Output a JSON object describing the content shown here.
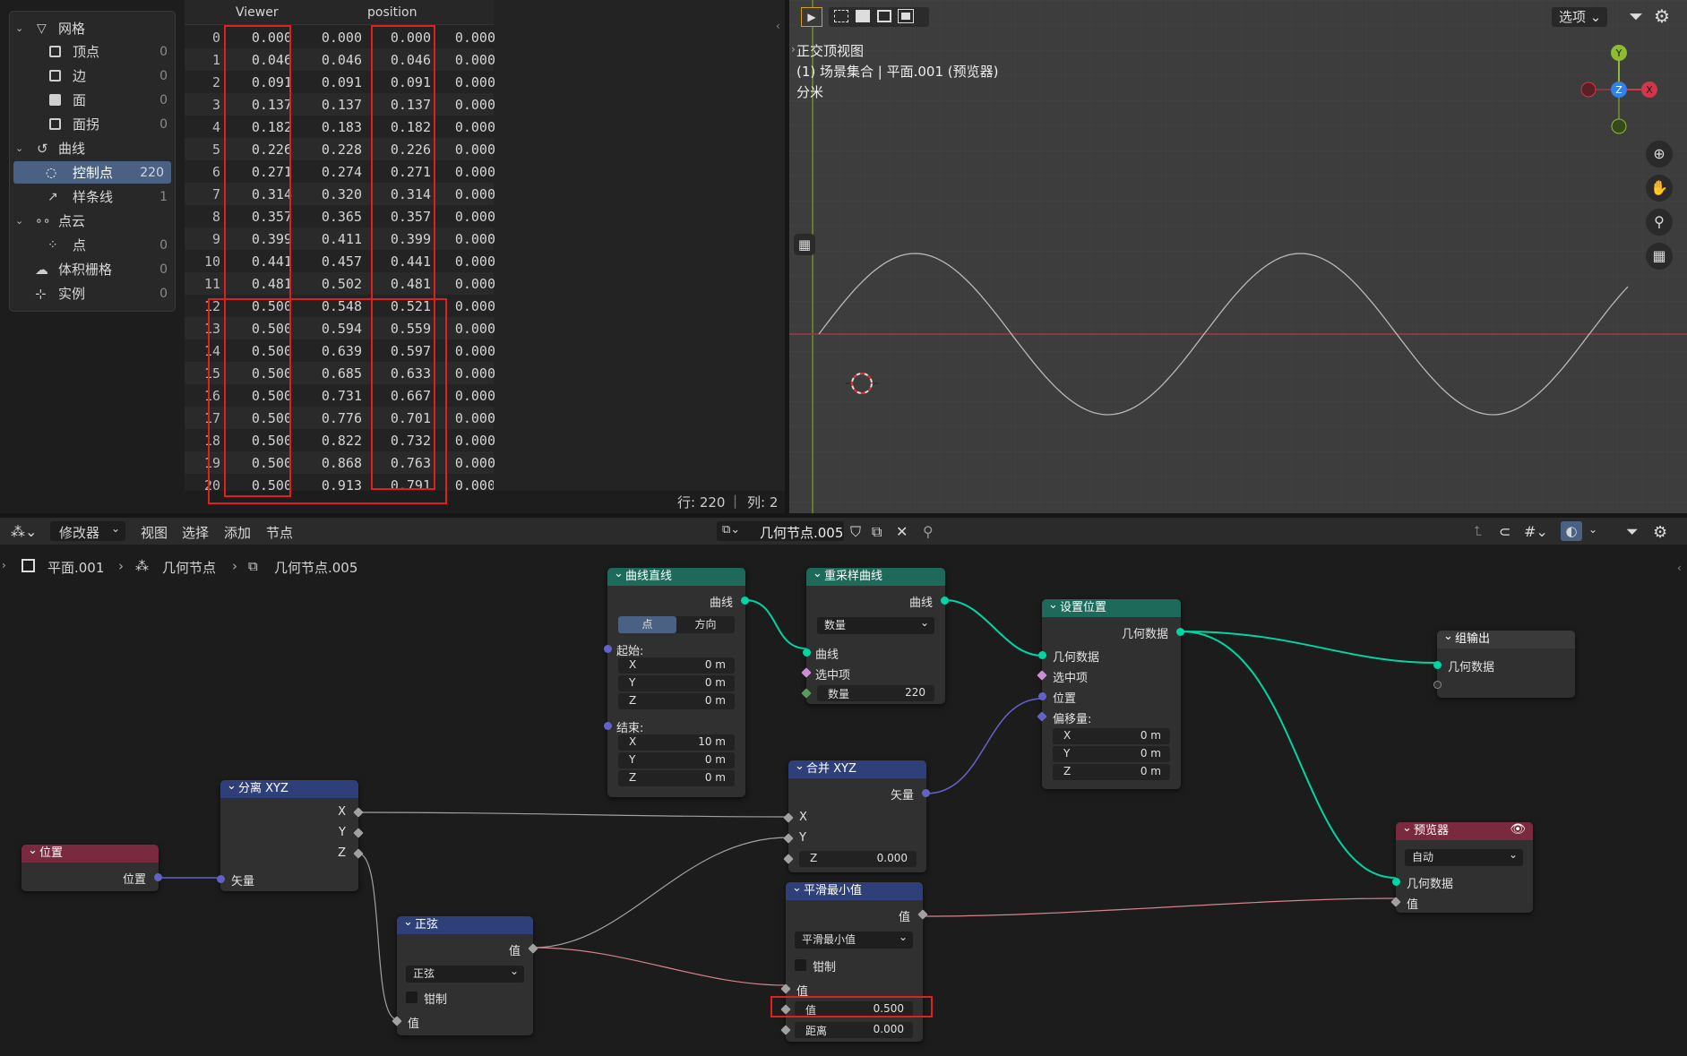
{
  "sidebar": {
    "items": [
      {
        "label": "网格",
        "count": ""
      },
      {
        "label": "顶点",
        "count": "0"
      },
      {
        "label": "边",
        "count": "0"
      },
      {
        "label": "面",
        "count": "0"
      },
      {
        "label": "面拐",
        "count": "0"
      },
      {
        "label": "曲线",
        "count": ""
      },
      {
        "label": "控制点",
        "count": "220"
      },
      {
        "label": "样条线",
        "count": "1"
      },
      {
        "label": "点云",
        "count": ""
      },
      {
        "label": "点",
        "count": "0"
      },
      {
        "label": "体积栅格",
        "count": "0"
      },
      {
        "label": "实例",
        "count": "0"
      }
    ]
  },
  "sheet": {
    "col_viewer": "Viewer",
    "col_position": "position",
    "rows": [
      [
        "0",
        "0.000",
        "0.000",
        "0.000",
        "0.000"
      ],
      [
        "1",
        "0.046",
        "0.046",
        "0.046",
        "0.000"
      ],
      [
        "2",
        "0.091",
        "0.091",
        "0.091",
        "0.000"
      ],
      [
        "3",
        "0.137",
        "0.137",
        "0.137",
        "0.000"
      ],
      [
        "4",
        "0.182",
        "0.183",
        "0.182",
        "0.000"
      ],
      [
        "5",
        "0.226",
        "0.228",
        "0.226",
        "0.000"
      ],
      [
        "6",
        "0.271",
        "0.274",
        "0.271",
        "0.000"
      ],
      [
        "7",
        "0.314",
        "0.320",
        "0.314",
        "0.000"
      ],
      [
        "8",
        "0.357",
        "0.365",
        "0.357",
        "0.000"
      ],
      [
        "9",
        "0.399",
        "0.411",
        "0.399",
        "0.000"
      ],
      [
        "10",
        "0.441",
        "0.457",
        "0.441",
        "0.000"
      ],
      [
        "11",
        "0.481",
        "0.502",
        "0.481",
        "0.000"
      ],
      [
        "12",
        "0.500",
        "0.548",
        "0.521",
        "0.000"
      ],
      [
        "13",
        "0.500",
        "0.594",
        "0.559",
        "0.000"
      ],
      [
        "14",
        "0.500",
        "0.639",
        "0.597",
        "0.000"
      ],
      [
        "15",
        "0.500",
        "0.685",
        "0.633",
        "0.000"
      ],
      [
        "16",
        "0.500",
        "0.731",
        "0.667",
        "0.000"
      ],
      [
        "17",
        "0.500",
        "0.776",
        "0.701",
        "0.000"
      ],
      [
        "18",
        "0.500",
        "0.822",
        "0.732",
        "0.000"
      ],
      [
        "19",
        "0.500",
        "0.868",
        "0.763",
        "0.000"
      ],
      [
        "20",
        "0.500",
        "0.913",
        "0.791",
        "0.000"
      ]
    ],
    "rows_label": "行: 220",
    "cols_label": "列: 2"
  },
  "viewport": {
    "options": "选项",
    "view_name": "正交顶视图",
    "collection": "(1) 场景集合 | 平面.001 (预览器)",
    "units": "分米",
    "axis_x": "X",
    "axis_y": "Y",
    "axis_z": "Z"
  },
  "node_header": {
    "modifier": "修改器",
    "menu_view": "视图",
    "menu_select": "选择",
    "menu_add": "添加",
    "menu_node": "节点",
    "tree_name": "几何节点.005",
    "crumb_object": "平面.001",
    "crumb_modifier": "几何节点",
    "crumb_tree": "几何节点.005"
  },
  "nodes": {
    "curve_line": {
      "title": "曲线直线",
      "out": "曲线",
      "tab_point": "点",
      "tab_dir": "方向",
      "start": "起始:",
      "end": "结束:",
      "sx": "0 m",
      "sy": "0 m",
      "sz": "0 m",
      "ex": "10 m",
      "ey": "0 m",
      "ez": "0 m",
      "x": "X",
      "y": "Y",
      "z": "Z"
    },
    "resample": {
      "title": "重采样曲线",
      "out": "曲线",
      "mode": "数量",
      "in_curve": "曲线",
      "in_sel": "选中项",
      "count_label": "数量",
      "count": "220"
    },
    "set_pos": {
      "title": "设置位置",
      "out": "几何数据",
      "in_geo": "几何数据",
      "in_sel": "选中项",
      "in_pos": "位置",
      "in_off": "偏移量:",
      "ox": "0 m",
      "oy": "0 m",
      "oz": "0 m",
      "x": "X",
      "y": "Y",
      "z": "Z"
    },
    "group_out": {
      "title": "组输出",
      "in_geo": "几何数据"
    },
    "separate": {
      "title": "分离 XYZ",
      "x": "X",
      "y": "Y",
      "z": "Z",
      "in": "矢量"
    },
    "position": {
      "title": "位置",
      "out": "位置"
    },
    "combine": {
      "title": "合并 XYZ",
      "out": "矢量",
      "x": "X",
      "y": "Y",
      "z_label": "Z",
      "z": "0.000"
    },
    "sine": {
      "title": "正弦",
      "out": "值",
      "mode": "正弦",
      "clamp": "钳制",
      "in": "值"
    },
    "smooth_min": {
      "title": "平滑最小值",
      "out": "值",
      "mode": "平滑最小值",
      "clamp": "钳制",
      "in": "值",
      "val_label": "值",
      "val": "0.500",
      "dist_label": "距离",
      "dist": "0.000"
    },
    "viewer": {
      "title": "预览器",
      "mode": "自动",
      "in_geo": "几何数据",
      "in_val": "值"
    }
  }
}
